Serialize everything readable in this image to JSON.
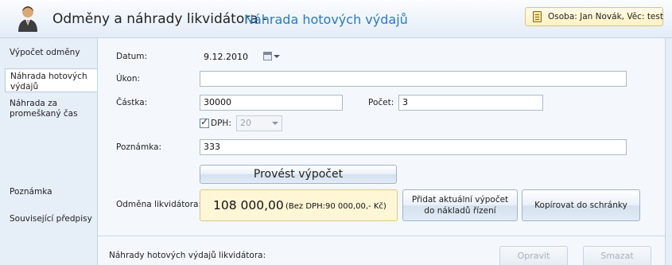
{
  "header": {
    "title": "Odměny a náhrady likvidátora -",
    "subtitle": "Náhrada hotových výdajů",
    "person": "Osoba: Jan Novák, Věc: test"
  },
  "sidebar": {
    "items": [
      {
        "label": "Výpočet odměny"
      },
      {
        "label": "Náhrada hotových výdajů"
      },
      {
        "label": "Náhrada za promeškaný čas"
      },
      {
        "label": "Poznámka"
      },
      {
        "label": "Související předpisy"
      }
    ]
  },
  "form": {
    "datum_label": "Datum:",
    "datum_value": "9.12.2010",
    "ukon_label": "Úkon:",
    "ukon_value": "",
    "castka_label": "Částka:",
    "castka_value": "30000",
    "pocet_label": "Počet:",
    "pocet_value": "3",
    "dph_label": "DPH:",
    "dph_value": "20",
    "poznamka_label": "Poznámka:",
    "poznamka_value": "333"
  },
  "actions": {
    "calculate": "Provést výpočet",
    "reward_label": "Odměna likvidátora:",
    "reward_value": "108 000,00",
    "reward_detail": "(Bez DPH:90 000,00,- Kč)",
    "add_line1": "Přidat aktuální výpočet",
    "add_line2": "do nákladů řízení",
    "copy": "Kopírovat do schránky"
  },
  "list": {
    "label": "Náhrady hotových výdajů likvidátora:",
    "edit": "Opravit",
    "delete": "Smazat"
  }
}
